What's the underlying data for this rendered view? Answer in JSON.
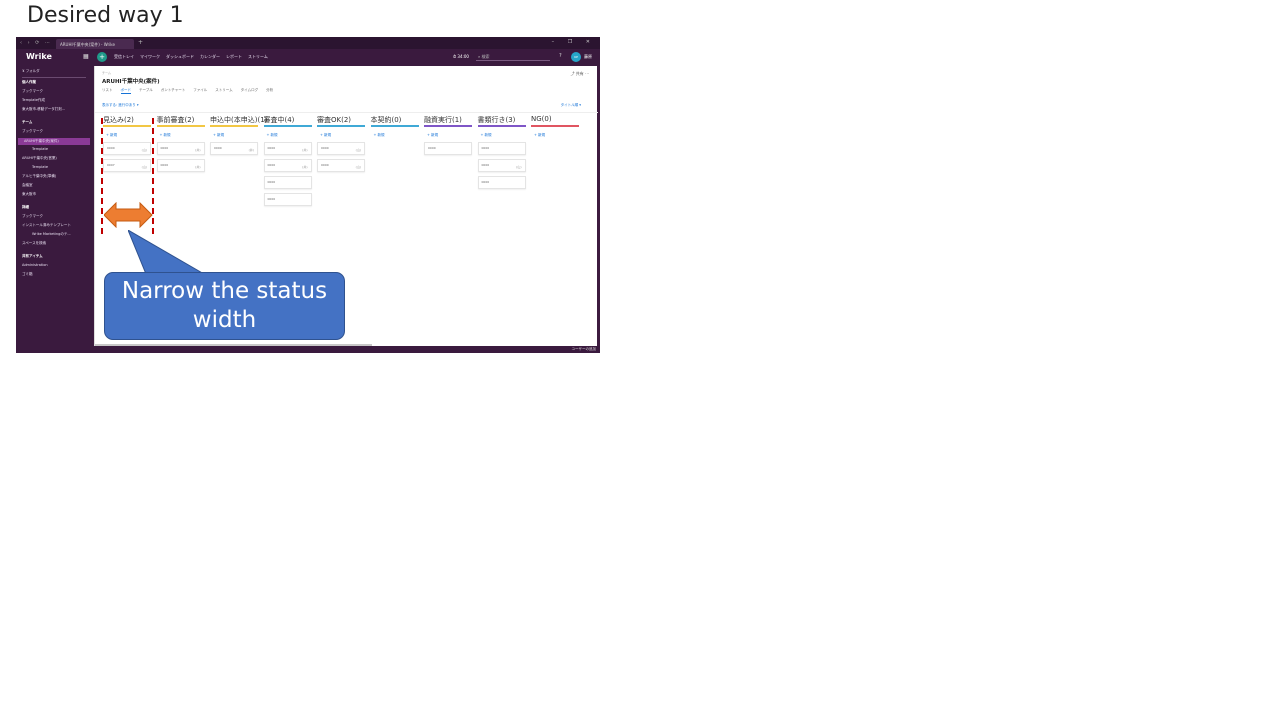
{
  "slide": {
    "title": "Desired way 1"
  },
  "browser": {
    "tab_title": "ARUHI千葉中央(案件) - Wrike",
    "new_tab": "+",
    "window_controls": "– ❐ ✕",
    "nav_controls": "‹ › ⟳ ⋯"
  },
  "app": {
    "logo": "Wrike",
    "top_nav": [
      "受信トレイ",
      "マイワーク",
      "ダッシュボード",
      "カレンダー",
      "レポート",
      "ストリーム"
    ],
    "timer": "34:00",
    "search_placeholder": "検索",
    "user": "藤原"
  },
  "sidebar": {
    "filter": "フォルダ",
    "items": [
      {
        "label": "個人作業",
        "bold": true
      },
      {
        "label": "ブックマーク"
      },
      {
        "label": "Template作成"
      },
      {
        "label": "東大阪市-移動データ打刻..."
      },
      {
        "label": "チーム",
        "bold": true
      },
      {
        "label": "ブックマーク"
      },
      {
        "label": "ARUHI千葉中央(案件)",
        "selected": true
      },
      {
        "label": "Template",
        "indent": true
      },
      {
        "label": "ARUHI千葉中央(営業)"
      },
      {
        "label": "Template",
        "indent": true
      },
      {
        "label": "アルヒ千葉中央(準備)"
      },
      {
        "label": "会議室"
      },
      {
        "label": "東大阪市"
      },
      {
        "label": "詳細",
        "bold": true
      },
      {
        "label": "ブックマーク"
      },
      {
        "label": "インストール済みテンプレート"
      },
      {
        "label": "Wrike Marketingのテ...",
        "indent": true
      },
      {
        "label": "スペースを検索"
      },
      {
        "label": "共有アイテム",
        "bold": true
      },
      {
        "label": "Administration"
      },
      {
        "label": "ゴミ箱"
      }
    ]
  },
  "project": {
    "breadcrumb": "チーム",
    "title": "ARUHI千葉中央(案件)",
    "share_label": "共有 ⋯",
    "view_tabs": [
      "リスト",
      "ボード",
      "テーブル",
      "ガントチャート",
      "ファイル",
      "ストリーム",
      "タイムログ",
      "分析"
    ],
    "active_view": "ボード",
    "filter_text": "表示する: 進行中あり ▾",
    "filter_right": "タイトル順 ▾",
    "new_item": "+ 新規"
  },
  "board": {
    "columns": [
      {
        "name": "見込み(2)",
        "color": "#f2c744",
        "cards": [
          {
            "t": "0000",
            "m": "(山)"
          },
          {
            "t": "0007",
            "m": "(山)"
          }
        ]
      },
      {
        "name": "事前審査(2)",
        "color": "#f2c744",
        "cards": [
          {
            "t": "0000",
            "m": "(井)"
          },
          {
            "t": "0000",
            "m": "(井)"
          }
        ]
      },
      {
        "name": "申込中(本申込)(1)",
        "color": "#f2c744",
        "cards": [
          {
            "t": "0000",
            "m": "(井)"
          }
        ]
      },
      {
        "name": "審査中(4)",
        "color": "#3fa9d6",
        "cards": [
          {
            "t": "0000",
            "m": "(井)"
          },
          {
            "t": "0000",
            "m": "(井)"
          },
          {
            "t": "0000",
            "m": ""
          },
          {
            "t": "0000",
            "m": ""
          }
        ]
      },
      {
        "name": "審査OK(2)",
        "color": "#3fa9d6",
        "cards": [
          {
            "t": "0000",
            "m": "(山)"
          },
          {
            "t": "0000",
            "m": "(山)"
          }
        ]
      },
      {
        "name": "本契約(0)",
        "color": "#3fa9d6",
        "cards": []
      },
      {
        "name": "融資実行(1)",
        "color": "#7f56c7",
        "cards": [
          {
            "t": "0000",
            "m": ""
          }
        ]
      },
      {
        "name": "書類行き(3)",
        "color": "#7f56c7",
        "cards": [
          {
            "t": "0000",
            "m": ""
          },
          {
            "t": "0000",
            "m": "(山)"
          },
          {
            "t": "0000",
            "m": ""
          }
        ]
      },
      {
        "name": "NG(0)",
        "color": "#e05561",
        "cards": []
      }
    ]
  },
  "statusbar": {
    "right": "ユーザーの追加"
  },
  "annotation": {
    "callout": "Narrow the status width",
    "arrow_color": "#ed7d31",
    "dash_color": "#c00000",
    "callout_color": "#4472c4"
  }
}
